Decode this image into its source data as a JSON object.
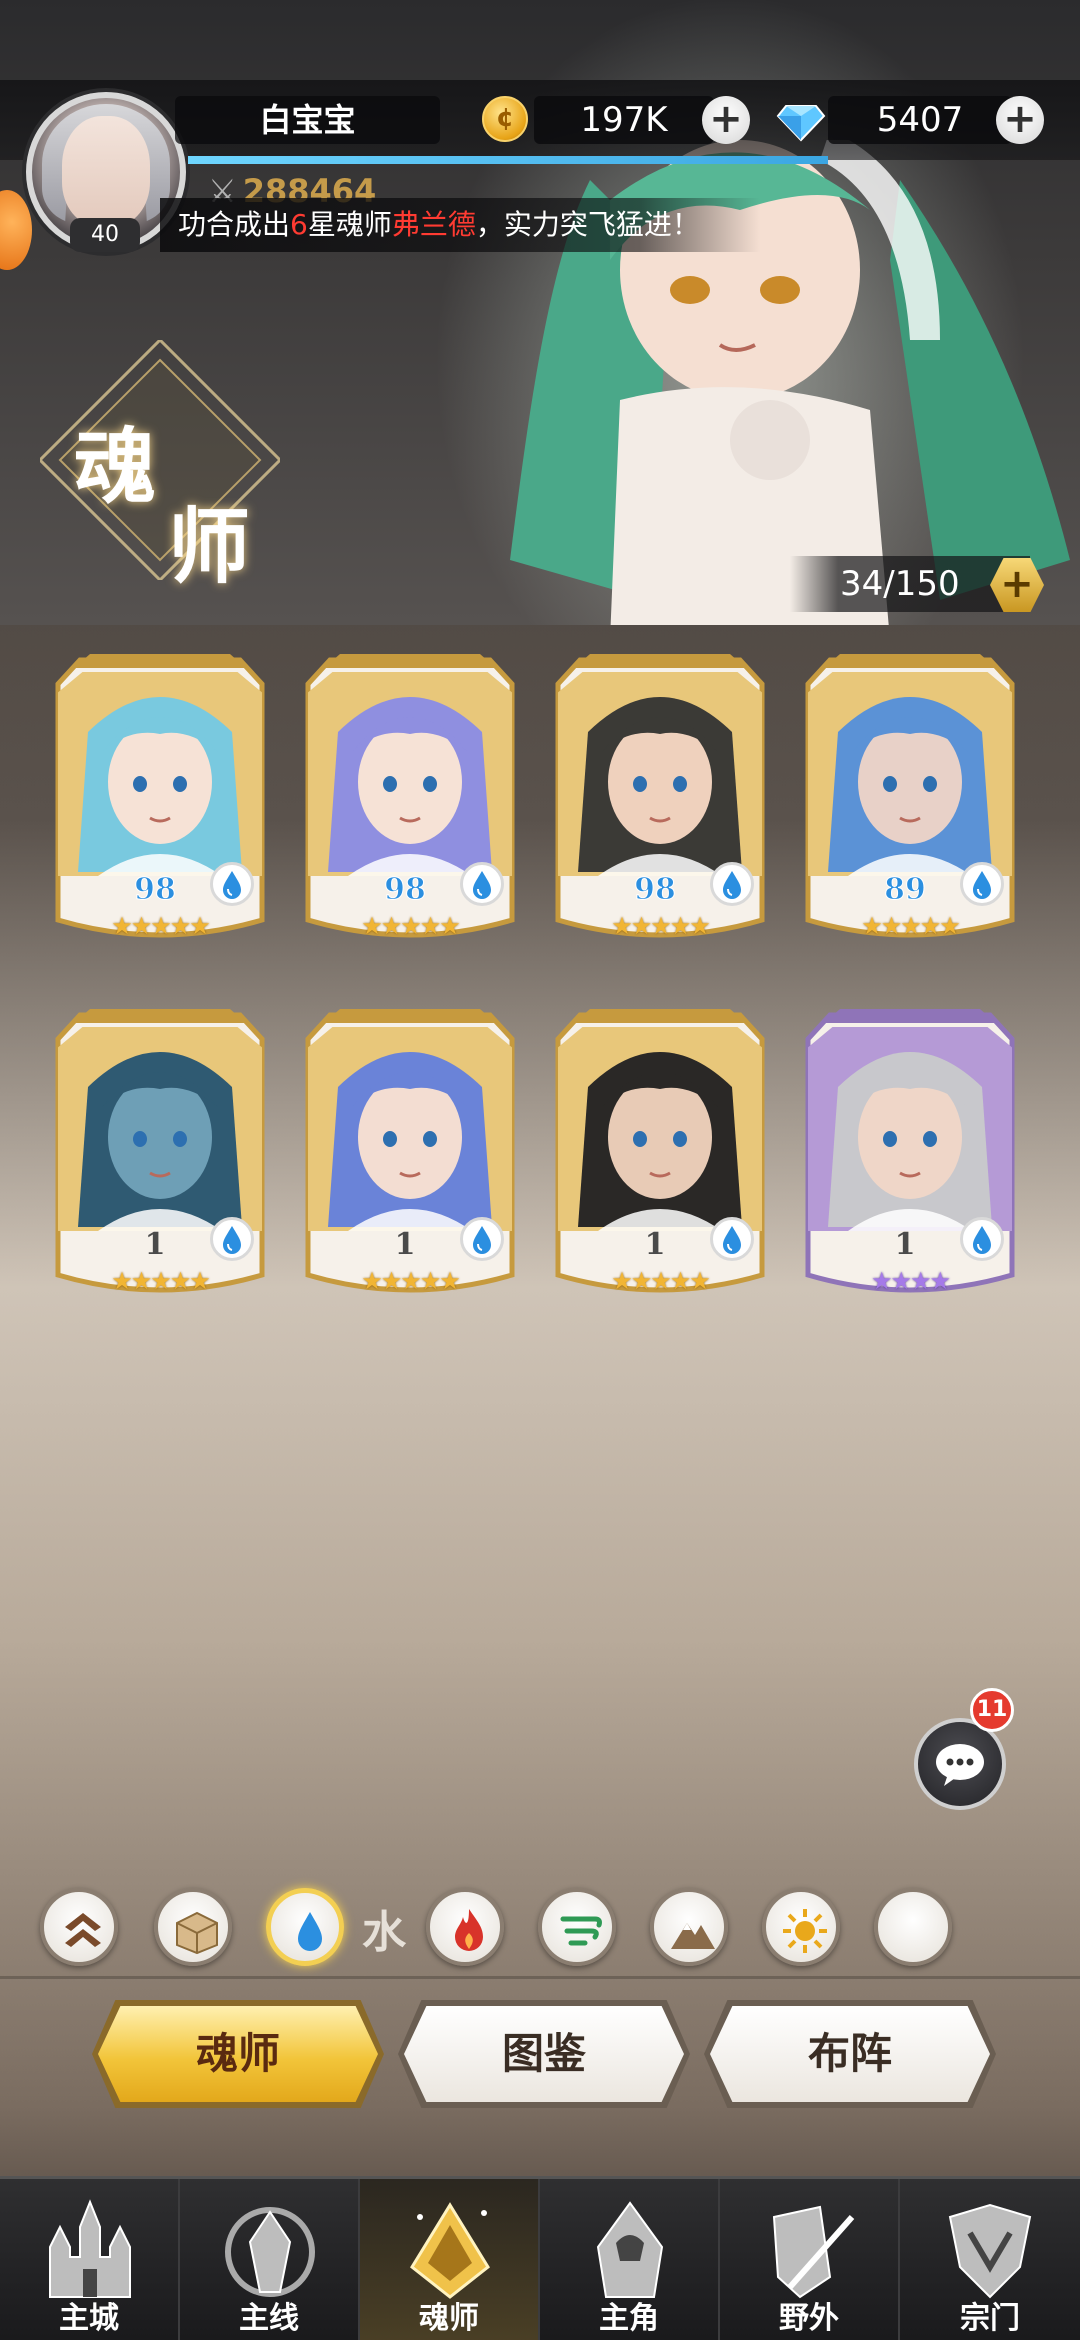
{
  "player": {
    "name": "白宝宝",
    "level": "40",
    "power": "288464",
    "xp_fraction": 1.0
  },
  "resources": {
    "gold": "197K",
    "diamonds": "5407"
  },
  "news": {
    "prefix": "功合成出",
    "star": "6",
    "middle": "星魂师",
    "hero": "弗兰德",
    "suffix": "，实力突飞猛进！"
  },
  "page_title": {
    "char1": "魂",
    "char2": "师"
  },
  "capacity": "34/150",
  "heroes": [
    {
      "level": "98",
      "stars": "★★★★★",
      "rarity": "gold",
      "element": "water-icon",
      "hair": "#79c9df",
      "skin": "#f6e2d6",
      "bg": "#e8c77a"
    },
    {
      "level": "98",
      "stars": "★★★★★",
      "rarity": "gold",
      "element": "water-icon",
      "hair": "#8f8fe0",
      "skin": "#f6e2d6",
      "bg": "#e8c77a"
    },
    {
      "level": "98",
      "stars": "★★★★★",
      "rarity": "gold",
      "element": "water-icon",
      "hair": "#3b3a36",
      "skin": "#efd1bd",
      "bg": "#e8c77a"
    },
    {
      "level": "89",
      "stars": "★★★★★",
      "rarity": "gold",
      "element": "water-icon",
      "hair": "#5b92d6",
      "skin": "#e8d1c8",
      "bg": "#e8c77a"
    },
    {
      "level": "1",
      "stars": "★★★★★",
      "rarity": "gold",
      "element": "water-icon",
      "hair": "#2f5a72",
      "skin": "#6e9fb6",
      "bg": "#e8c77a"
    },
    {
      "level": "1",
      "stars": "★★★★★",
      "rarity": "gold",
      "element": "water-icon",
      "hair": "#6a83d8",
      "skin": "#f3ddd2",
      "bg": "#e8c77a"
    },
    {
      "level": "1",
      "stars": "★★★★★",
      "rarity": "gold",
      "element": "water-icon",
      "hair": "#2a2826",
      "skin": "#e8cbb6",
      "bg": "#e8c77a"
    },
    {
      "level": "1",
      "stars": "★★★★",
      "rarity": "purple",
      "element": "water-icon",
      "hair": "#c8c8cc",
      "skin": "#efd6c8",
      "bg": "#b59ad6"
    }
  ],
  "chat": {
    "badge": "11"
  },
  "filters": {
    "items": [
      "sort-icon",
      "box-icon",
      "water-icon",
      "fire-icon",
      "wind-icon",
      "earth-icon",
      "light-icon",
      "dark-icon"
    ],
    "active_label": "水"
  },
  "tabs": [
    "魂师",
    "图鉴",
    "布阵"
  ],
  "nav": [
    "主城",
    "主线",
    "魂师",
    "主角",
    "野外",
    "宗门"
  ],
  "colors": {
    "gold_accent": "#f2c53a",
    "water": "#2b8fe0",
    "news_highlight": "#ff3b32"
  }
}
